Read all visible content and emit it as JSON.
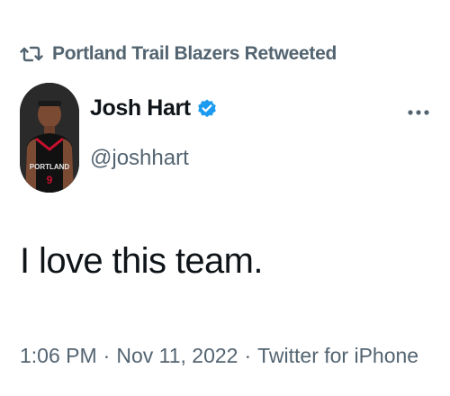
{
  "retweet_banner": {
    "icon": "retweet-icon",
    "text": "Portland Trail Blazers Retweeted"
  },
  "author": {
    "display_name": "Josh Hart",
    "handle": "@joshhart",
    "verified_icon": "verified-badge-icon",
    "avatar_jersey_text": "PORTLAND",
    "avatar_jersey_number": "9"
  },
  "more_icon": "more-options-icon",
  "tweet": {
    "text": "I love this team."
  },
  "meta": {
    "time": "1:06 PM",
    "separator": "·",
    "date": "Nov 11, 2022",
    "source": "Twitter for iPhone"
  },
  "colors": {
    "primary_text": "#0f1419",
    "secondary_text": "#536471",
    "verified_blue": "#1d9bf0"
  }
}
